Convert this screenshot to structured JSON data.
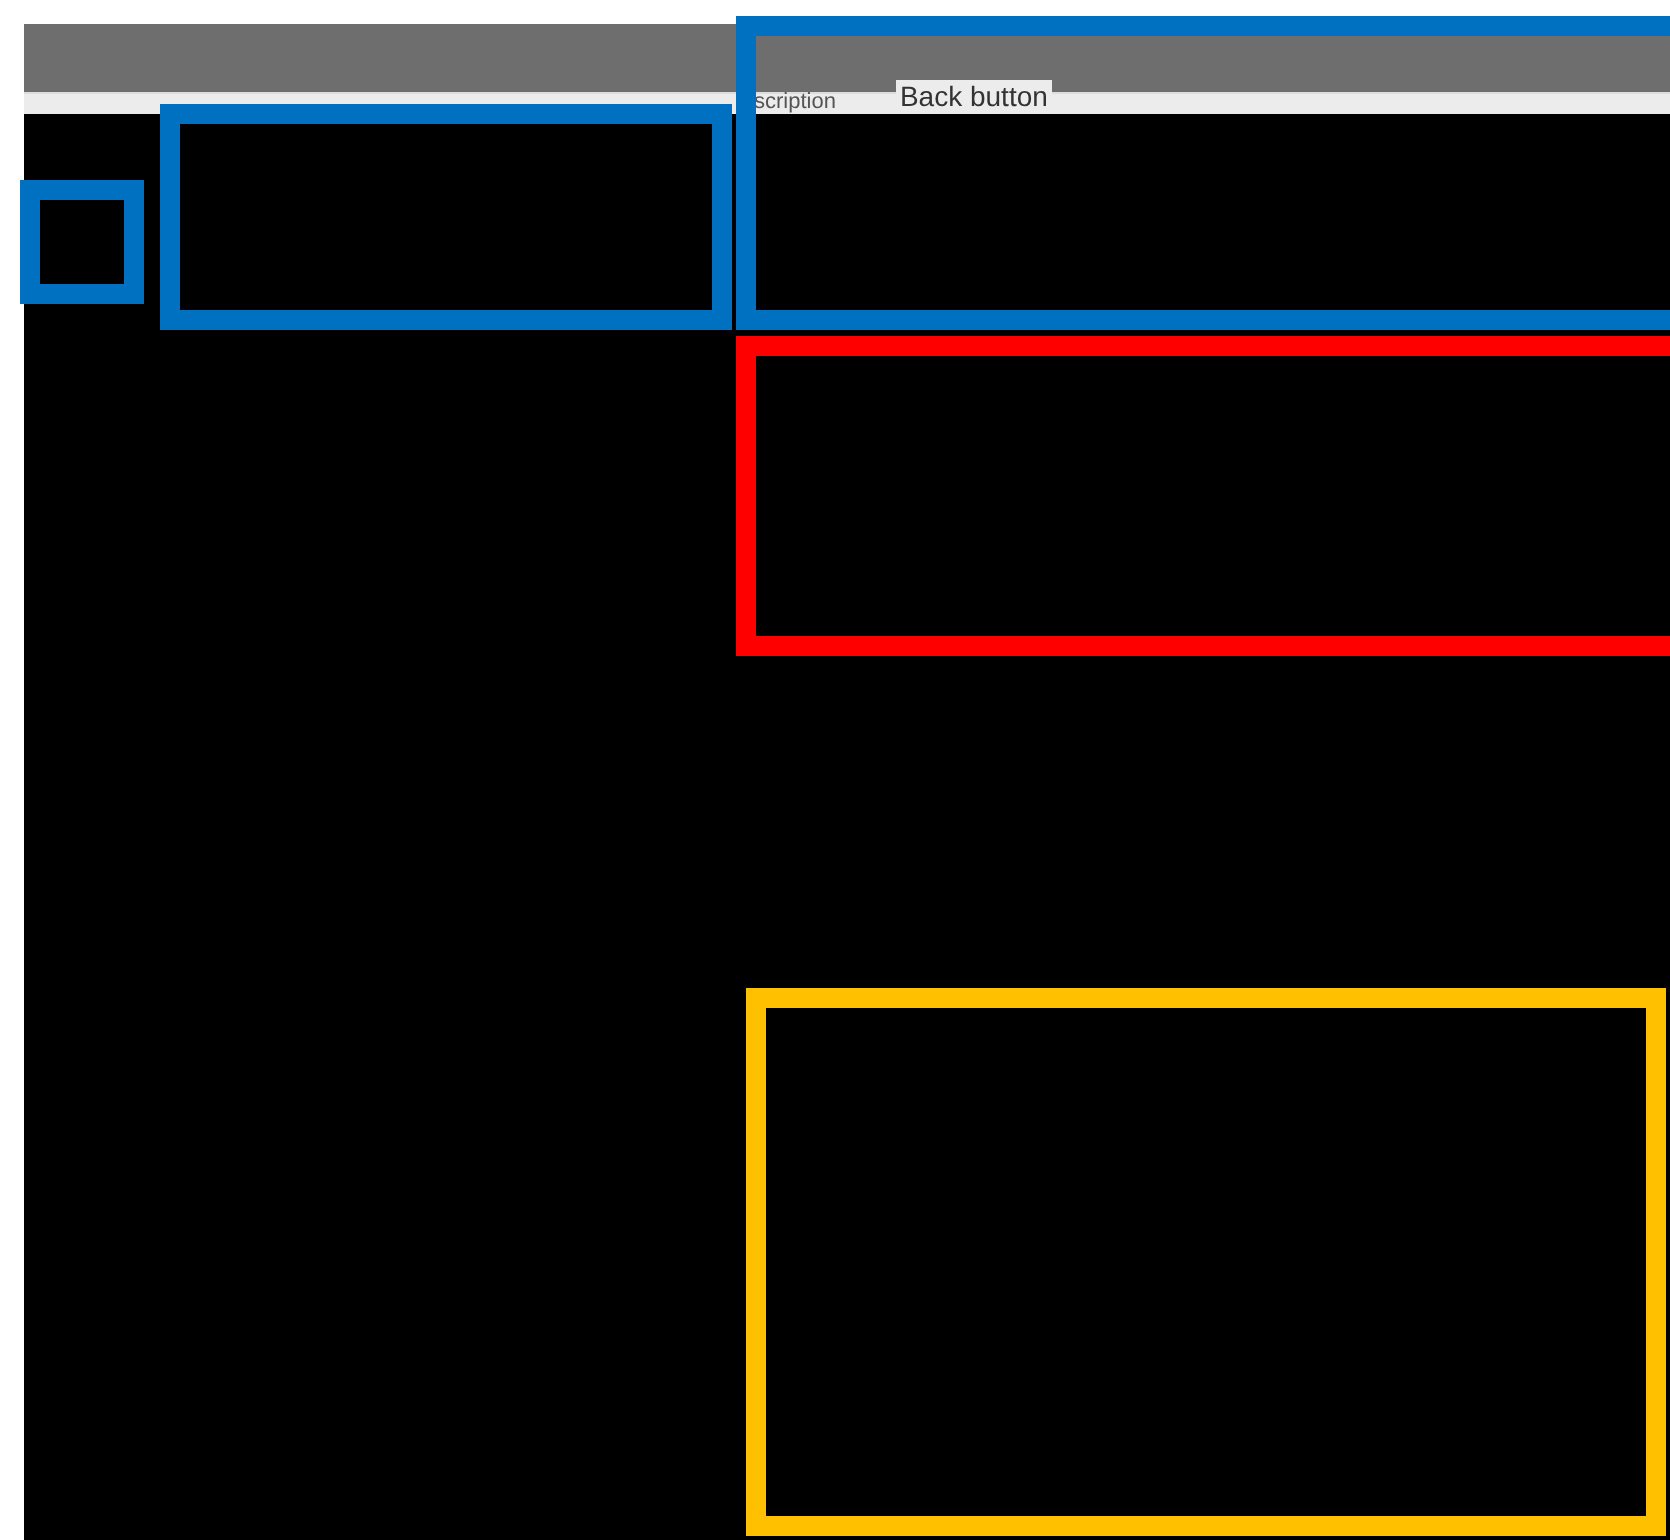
{
  "header_strip": {
    "field_label": "scription",
    "caption": "Back button"
  },
  "annotations": [
    {
      "color": "#0070c0"
    },
    {
      "color": "#0070c0"
    },
    {
      "color": "#0070c0"
    },
    {
      "color": "#ff0000"
    },
    {
      "color": "#ffc000"
    }
  ]
}
